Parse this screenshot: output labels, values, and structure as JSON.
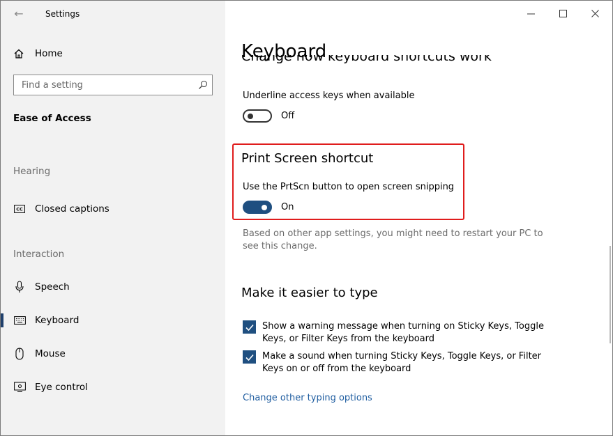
{
  "window": {
    "title": "Settings"
  },
  "sidebar": {
    "home_label": "Home",
    "search_placeholder": "Find a setting",
    "category": "Ease of Access",
    "sections": [
      {
        "heading": "Hearing",
        "items": [
          {
            "label": "Closed captions",
            "icon": "closed-captions-icon"
          }
        ]
      },
      {
        "heading": "Interaction",
        "items": [
          {
            "label": "Speech",
            "icon": "microphone-icon"
          },
          {
            "label": "Keyboard",
            "icon": "keyboard-icon",
            "active": true
          },
          {
            "label": "Mouse",
            "icon": "mouse-icon"
          },
          {
            "label": "Eye control",
            "icon": "eye-icon"
          }
        ]
      }
    ]
  },
  "main": {
    "title": "Keyboard",
    "clipped_heading": "Change how keyboard shortcuts work",
    "underline": {
      "label": "Underline access keys when available",
      "state": "Off"
    },
    "print_screen": {
      "heading": "Print Screen shortcut",
      "label": "Use the PrtScn button to open screen snipping",
      "state": "On",
      "note": "Based on other app settings, you might need to restart your PC to see this change."
    },
    "typing": {
      "heading": "Make it easier to type",
      "options": [
        {
          "text": "Show a warning message when turning on Sticky Keys, Toggle Keys, or Filter Keys from the keyboard",
          "checked": true
        },
        {
          "text": "Make a sound when turning Sticky Keys, Toggle Keys, or Filter Keys on or off from the keyboard",
          "checked": true
        }
      ],
      "link": "Change other typing options"
    }
  },
  "colors": {
    "accent": "#1f4f80",
    "highlight_border": "#e01c1c",
    "sidebar_bg": "#f2f2f2",
    "link": "#1f5da0"
  }
}
